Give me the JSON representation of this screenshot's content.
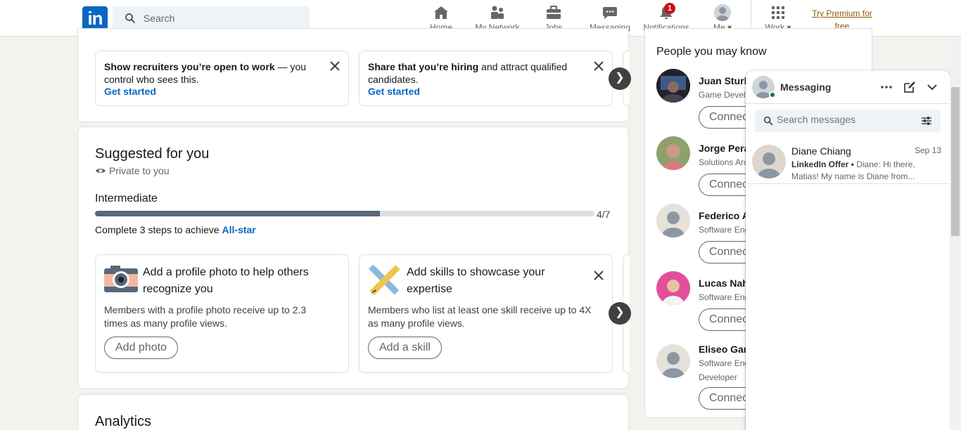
{
  "nav": {
    "logo_text": "in",
    "search_placeholder": "Search",
    "items": [
      {
        "label": "Home",
        "icon": "home-icon"
      },
      {
        "label": "My Network",
        "icon": "network-icon"
      },
      {
        "label": "Jobs",
        "icon": "briefcase-icon"
      },
      {
        "label": "Messaging",
        "icon": "chat-icon"
      },
      {
        "label": "Notifications",
        "icon": "bell-icon",
        "badge": "1"
      },
      {
        "label": "Me",
        "icon": "avatar-icon"
      },
      {
        "label": "Work",
        "icon": "grid-icon"
      }
    ],
    "premium_label": "Try Premium for free"
  },
  "open_to_work": {
    "cards": [
      {
        "bold": "Show recruiters you’re open to work",
        "rest": " — you control who sees this.",
        "link": "Get started"
      },
      {
        "bold": "Share that you’re hiring",
        "rest": " and attract qualified candidates.",
        "link": "Get started"
      }
    ],
    "next_arrow": "❯"
  },
  "suggested": {
    "title": "Suggested for you",
    "privacy": "Private to you",
    "level": "Intermediate",
    "progress_text": "4/7",
    "progress_fraction": 0.571,
    "steps_prefix": "Complete 3 steps to achieve ",
    "steps_link": "All-star",
    "cards": [
      {
        "title": "Add a profile photo to help others recognize you",
        "body": "Members with a profile photo receive up to 2.3 times as many profile views.",
        "button": "Add photo"
      },
      {
        "title": "Add skills to showcase your expertise",
        "body": "Members who list at least one skill receive up to 4X as many profile views.",
        "button": "Add a skill"
      }
    ],
    "next_arrow": "❯"
  },
  "analytics": {
    "title": "Analytics"
  },
  "pymk": {
    "title": "People you may know",
    "connect_label": "Connect",
    "people": [
      {
        "name": "Juan Sturla",
        "sub": "Game Developer"
      },
      {
        "name": "Jorge Peral",
        "sub": "Solutions Architect"
      },
      {
        "name": "Federico A",
        "sub": "Software Engineer"
      },
      {
        "name": "Lucas Nahu",
        "sub": "Software Engineer"
      },
      {
        "name": "Eliseo Gam",
        "sub": "Software Engineer",
        "sub2": "Developer"
      }
    ]
  },
  "messaging": {
    "title": "Messaging",
    "search_placeholder": "Search messages",
    "conversations": [
      {
        "name": "Diane Chiang",
        "date": "Sep 13",
        "tag": "LinkedIn Offer •",
        "preview": " Diane: Hi there, Matias! My name is Diane from..."
      }
    ]
  },
  "colors": {
    "brand": "#0a66c2",
    "badge": "#cc1016",
    "premium": "#915907",
    "progress": "#56687a"
  }
}
